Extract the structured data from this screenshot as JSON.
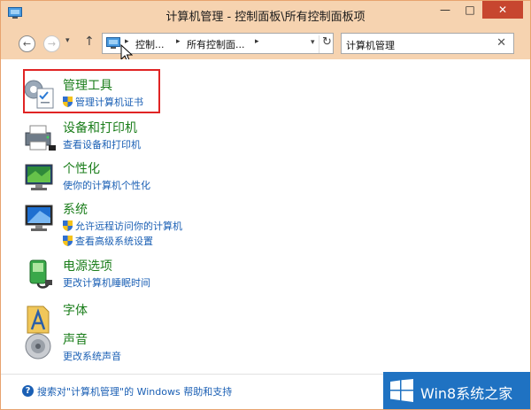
{
  "window": {
    "title": "计算机管理 - 控制面板\\所有控制面板项",
    "buttons": {
      "minimize": "—",
      "maximize": "□",
      "close": "✕"
    }
  },
  "nav": {
    "back": "←",
    "forward": "→",
    "dropdown": "▾",
    "up": "↑"
  },
  "address": {
    "crumbs": [
      "控制...",
      "所有控制面...",
      ""
    ],
    "separator": "▸",
    "dropdown": "▾",
    "refresh": "↻"
  },
  "search": {
    "value": "计算机管理",
    "clear": "✕"
  },
  "items": [
    {
      "title": "管理工具",
      "links": [
        {
          "label": "管理计算机证书",
          "shield": true
        }
      ],
      "icon": "admin-tools-icon"
    },
    {
      "title": "设备和打印机",
      "links": [
        {
          "label": "查看设备和打印机",
          "shield": false
        }
      ],
      "icon": "printer-icon"
    },
    {
      "title": "个性化",
      "links": [
        {
          "label": "使你的计算机个性化",
          "shield": false
        }
      ],
      "icon": "personalization-icon"
    },
    {
      "title": "系统",
      "links": [
        {
          "label": "允许远程访问你的计算机",
          "shield": true
        },
        {
          "label": "查看高级系统设置",
          "shield": true
        }
      ],
      "icon": "system-icon"
    },
    {
      "title": "电源选项",
      "links": [
        {
          "label": "更改计算机睡眠时间",
          "shield": false
        }
      ],
      "icon": "power-icon"
    },
    {
      "title": "字体",
      "links": [],
      "icon": "fonts-icon"
    },
    {
      "title": "声音",
      "links": [
        {
          "label": "更改系统声音",
          "shield": false
        }
      ],
      "icon": "sound-icon"
    }
  ],
  "footer": {
    "help_icon": "?",
    "help_text": "搜索对\"计算机管理\"的 Windows 帮助和支持"
  },
  "watermark": {
    "text": "Win8系统之家"
  },
  "colors": {
    "title_bar": "#f6d3b0",
    "link": "#1a5fb4",
    "category": "#1a7d1a",
    "highlight": "#e02424",
    "close": "#c7462f"
  }
}
